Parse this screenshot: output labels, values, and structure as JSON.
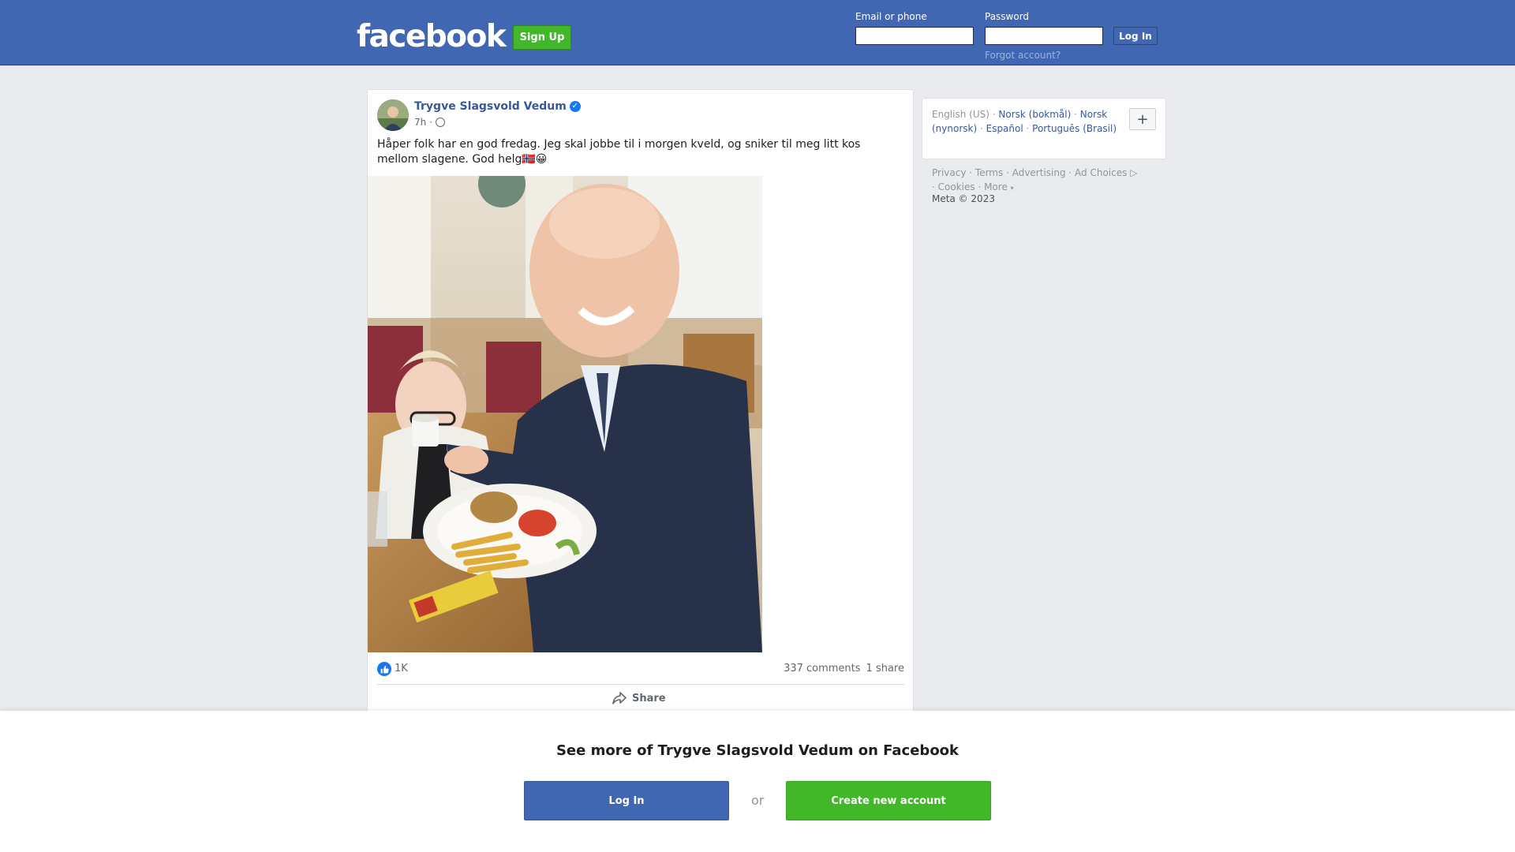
{
  "header": {
    "logo": "facebook",
    "signup_label": "Sign Up",
    "email_label": "Email or phone",
    "password_label": "Password",
    "login_label": "Log In",
    "forgot_label": "Forgot account?"
  },
  "post": {
    "author": "Trygve Slagsvold Vedum",
    "time": "7h",
    "separator": "·",
    "text": "Håper folk har en god fredag. Jeg skal jobbe til i morgen kveld, og sniker til meg litt kos mellom slagene. God helg🇳🇴😀",
    "likes": "1K",
    "comments": "337 comments",
    "shares": "1 share",
    "share_label": "Share"
  },
  "sidebar": {
    "languages": {
      "current": "English (US)",
      "lang1": "Norsk (bokmål)",
      "lang2": "Norsk (nynorsk)",
      "lang3": "Español",
      "lang4": "Português (Brasil)"
    },
    "plus_label": "+",
    "footer": {
      "privacy": "Privacy",
      "terms": "Terms",
      "advertising": "Advertising",
      "ad_choices": "Ad Choices",
      "cookies": "Cookies",
      "more": "More",
      "copyright": "Meta © 2023"
    }
  },
  "overlay": {
    "title": "See more of Trygve Slagsvold Vedum on Facebook",
    "login_label": "Log In",
    "or_label": "or",
    "create_label": "Create new account"
  },
  "colors": {
    "brand_blue": "#4267b2",
    "green": "#42b72a",
    "link": "#385898",
    "background": "#e9ebee"
  }
}
